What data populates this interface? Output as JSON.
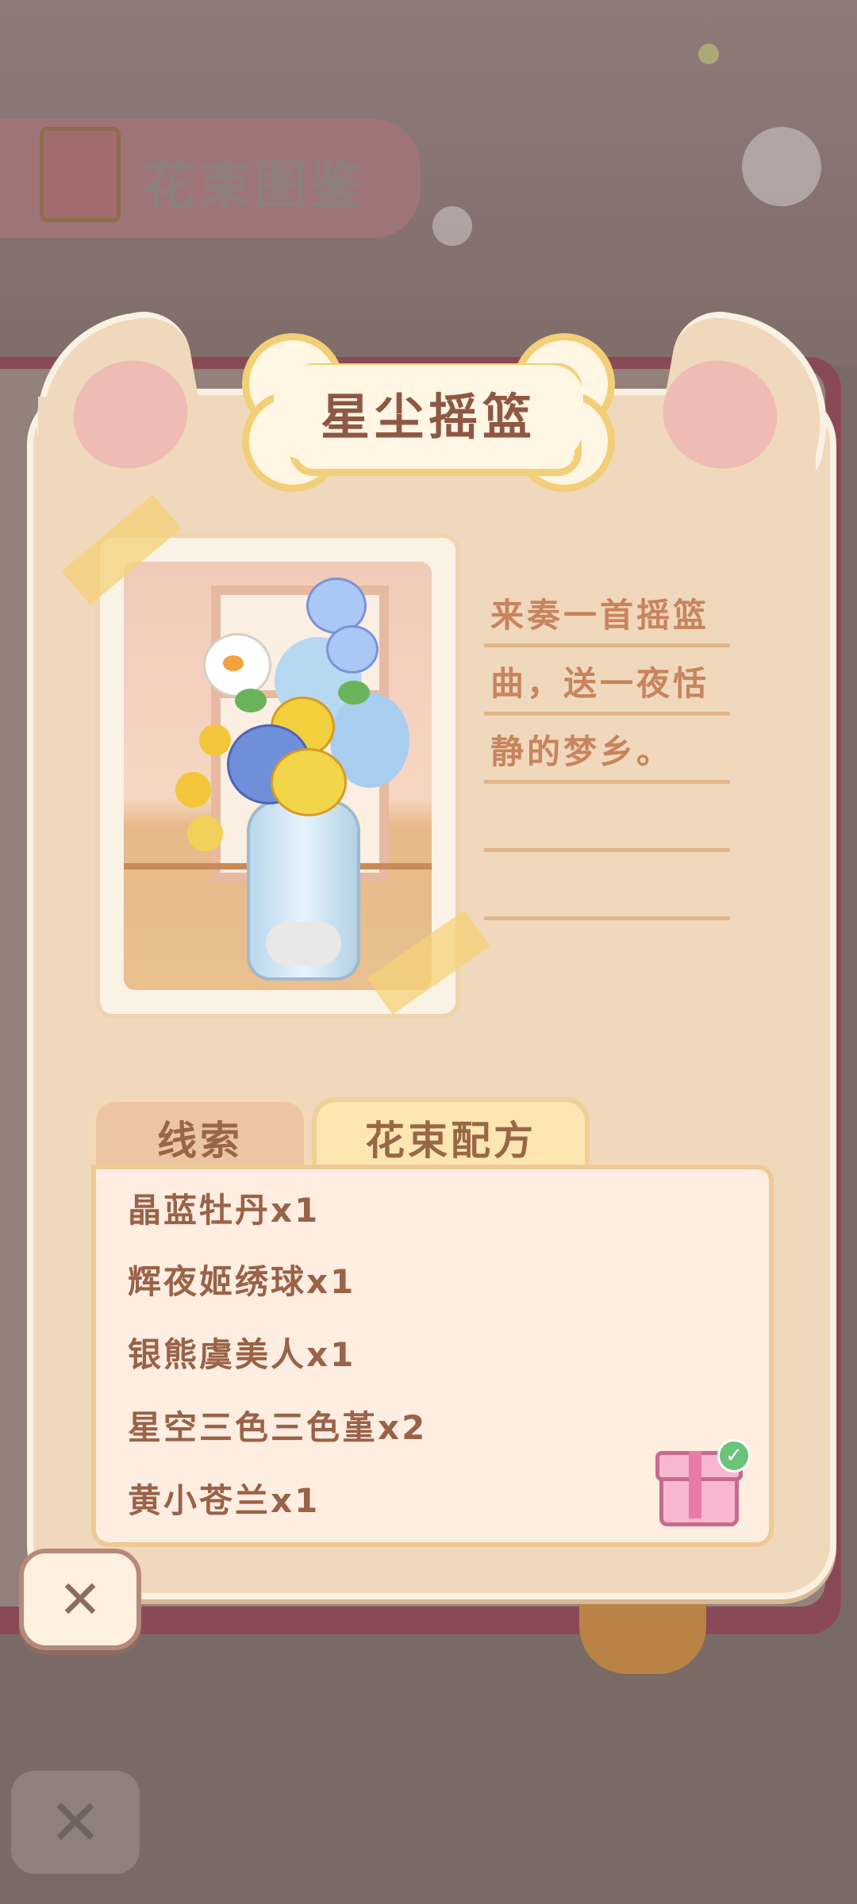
{
  "background": {
    "title": "花束图鉴"
  },
  "card": {
    "title": "星尘摇篮",
    "description_lines": [
      "来奏一首摇篮",
      "曲，送一夜恬",
      "静的梦乡。",
      "",
      ""
    ]
  },
  "tabs": [
    {
      "label": "线索",
      "active": false
    },
    {
      "label": "花束配方",
      "active": true
    }
  ],
  "recipe": {
    "ingredients": [
      "晶蓝牡丹x1",
      "辉夜姬绣球x1",
      "银熊虞美人x1",
      "星空三色三色堇x2",
      "黄小苍兰x1"
    ],
    "reward_claimed": true
  },
  "icons": {
    "close": "close-icon",
    "gift": "gift-icon",
    "check": "check-icon",
    "book": "book-icon"
  },
  "colors": {
    "accent_brown": "#8f5844",
    "tab_active": "#fde6b2",
    "card_bg": "#f0d8bd"
  }
}
